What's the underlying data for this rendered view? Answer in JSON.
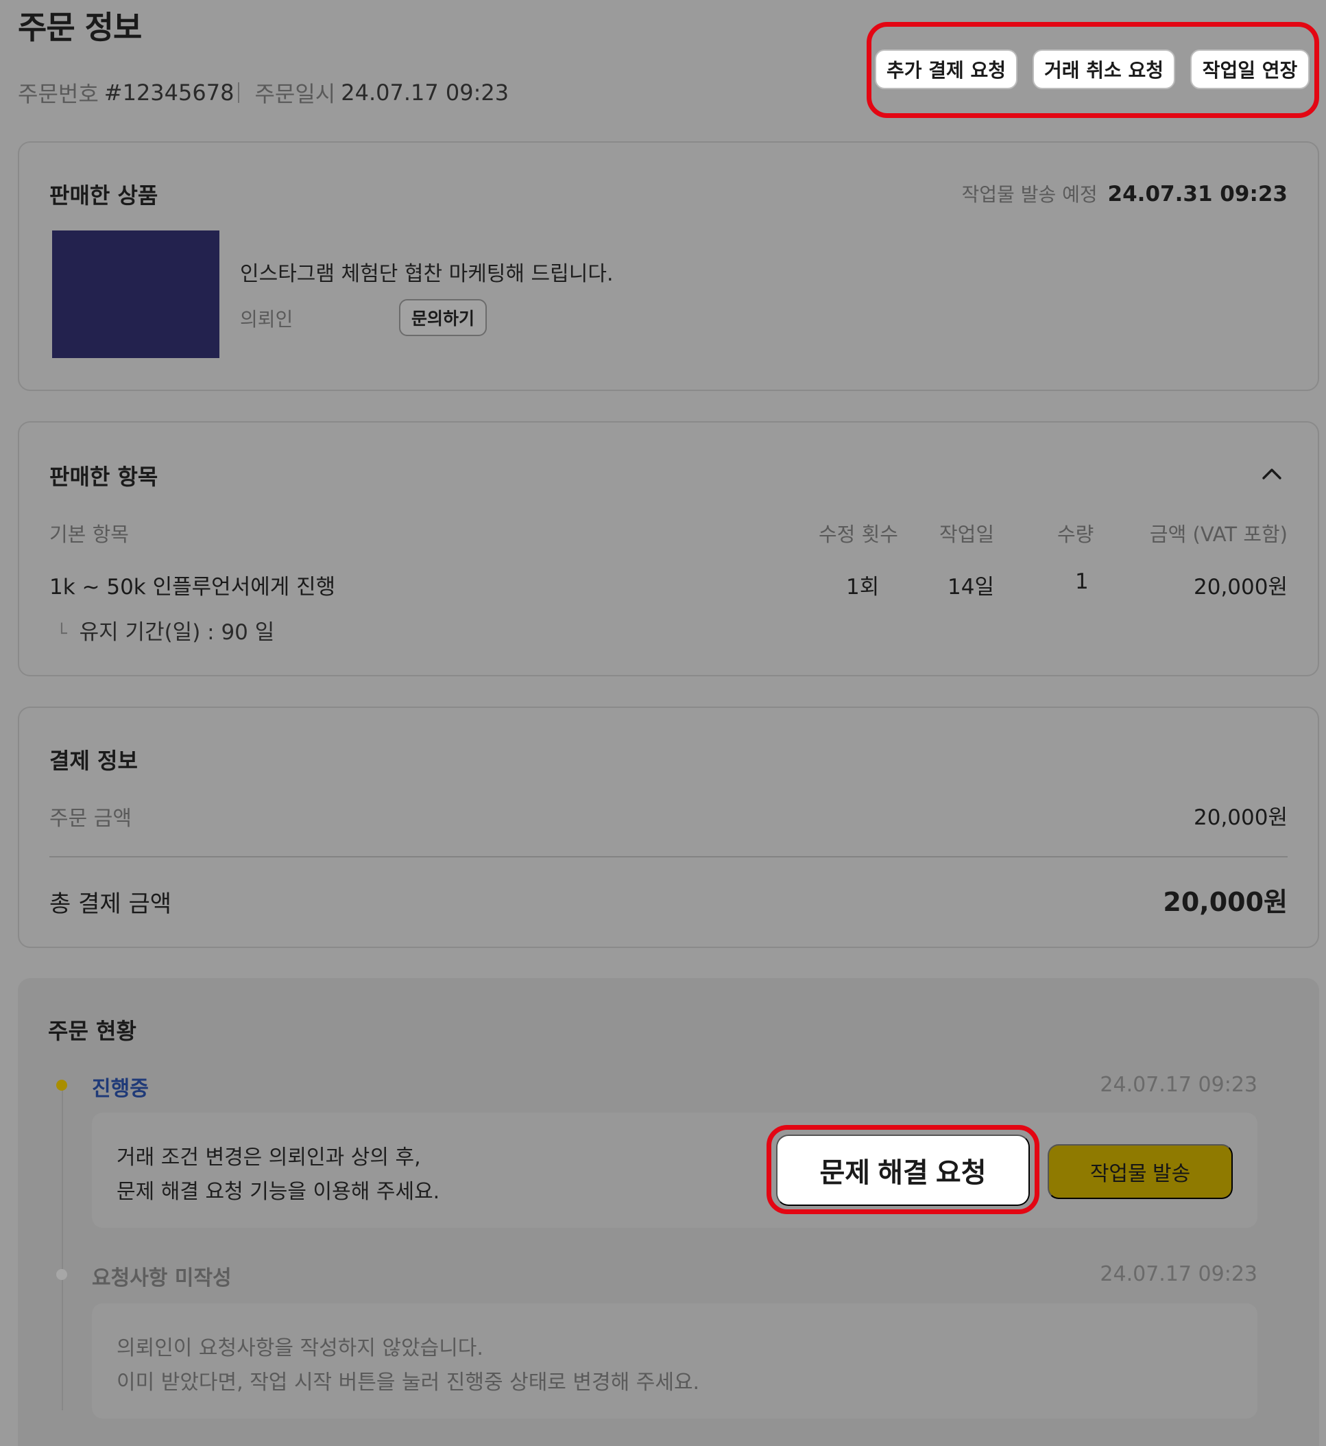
{
  "header": {
    "title": "주문 정보",
    "order_no_label": "주문번호",
    "order_no": "#12345678",
    "order_date_label": "주문일시",
    "order_date": "24.07.17 09:23"
  },
  "top_actions": {
    "extra_payment": "추가 결제 요청",
    "cancel_deal": "거래 취소 요청",
    "extend_workday": "작업일 연장"
  },
  "sold_product": {
    "title": "판매한 상품",
    "ship_label": "작업물 발송 예정",
    "ship_date": "24.07.31 09:23",
    "thumbnail_color": "#23224e",
    "name": "인스타그램 체험단 협찬 마케팅해 드립니다.",
    "client_label": "의뢰인",
    "inquiry_button": "문의하기"
  },
  "sold_items": {
    "title": "판매한 항목",
    "collapse_icon": "chevron-up-icon",
    "columns": [
      "기본 항목",
      "수정 횟수",
      "작업일",
      "수량",
      "금액 (VAT 포함)"
    ],
    "row": {
      "name": "1k ~ 50k 인플루언서에게 진행",
      "revisions": "1회",
      "workdays": "14일",
      "quantity": "1",
      "amount": "20,000원"
    },
    "option": "유지 기간(일) : 90 일",
    "option_marker": "└"
  },
  "payment": {
    "title": "결제 정보",
    "order_amount_label": "주문 금액",
    "order_amount": "20,000원",
    "total_label": "총 결제 금액",
    "total": "20,000원"
  },
  "status": {
    "title": "주문 현황",
    "items": [
      {
        "label": "진행중",
        "time": "24.07.17 09:23",
        "line1": "거래 조건 변경은 의뢰인과 상의 후,",
        "line2": "문제 해결 요청 기능을 이용해 주세요.",
        "resolve_button": "문제 해결 요청",
        "send_button": "작업물 발송"
      },
      {
        "label": "요청사항 미작성",
        "time": "24.07.17 09:23",
        "line1": "의뢰인이 요청사항을 작성하지 않았습니다.",
        "line2": "이미 받았다면, 작업 시작 버튼을 눌러 진행중 상태로 변경해 주세요."
      }
    ]
  },
  "colors": {
    "highlight": "#e30613",
    "accent": "#8f7a00",
    "active_status": "#1f3a78"
  }
}
